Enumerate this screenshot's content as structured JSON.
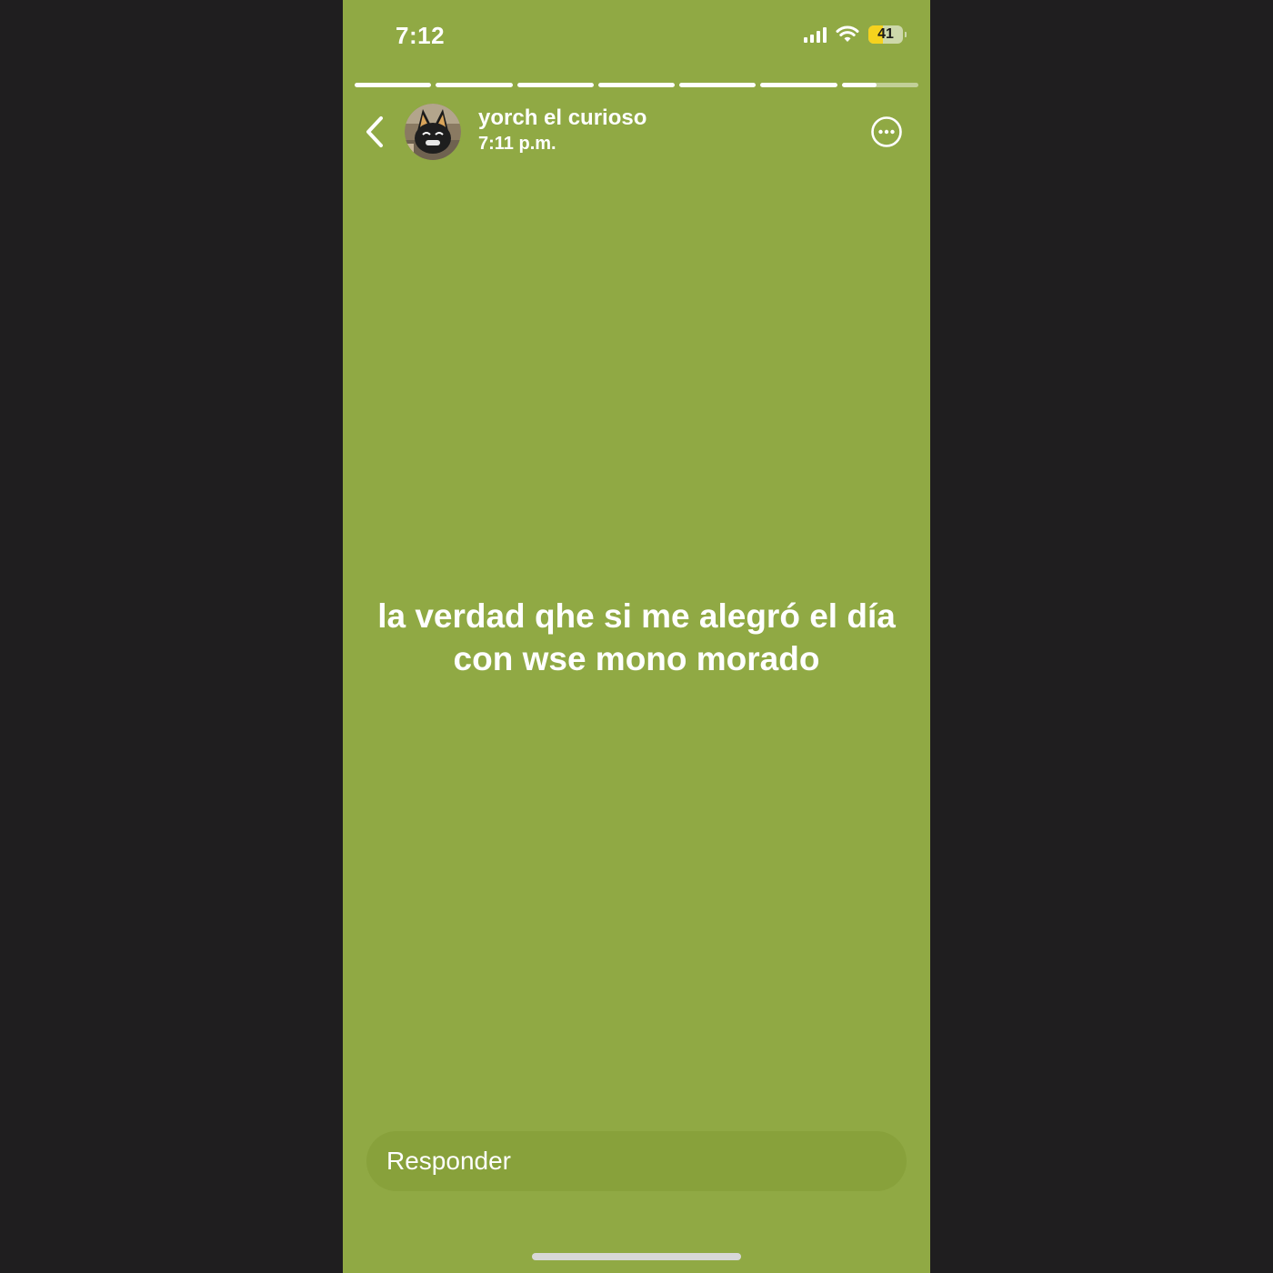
{
  "status_bar": {
    "time": "7:12",
    "battery_level": "41",
    "battery_fraction": 0.41,
    "signal_bars": 4,
    "icons": [
      "cellular-signal-icon",
      "wifi-icon",
      "battery-icon"
    ]
  },
  "story_progress": {
    "segments": [
      1,
      1,
      1,
      1,
      1,
      1,
      0.45
    ]
  },
  "header": {
    "username": "yorch el curioso",
    "post_time": "7:11 p.m.",
    "back_icon": "chevron-left-icon",
    "more_icon": "more-options-icon"
  },
  "story": {
    "text": "la verdad qhe si me alegró el día con wse mono morado",
    "background_color": "#90a944"
  },
  "reply": {
    "placeholder": "Responder"
  }
}
